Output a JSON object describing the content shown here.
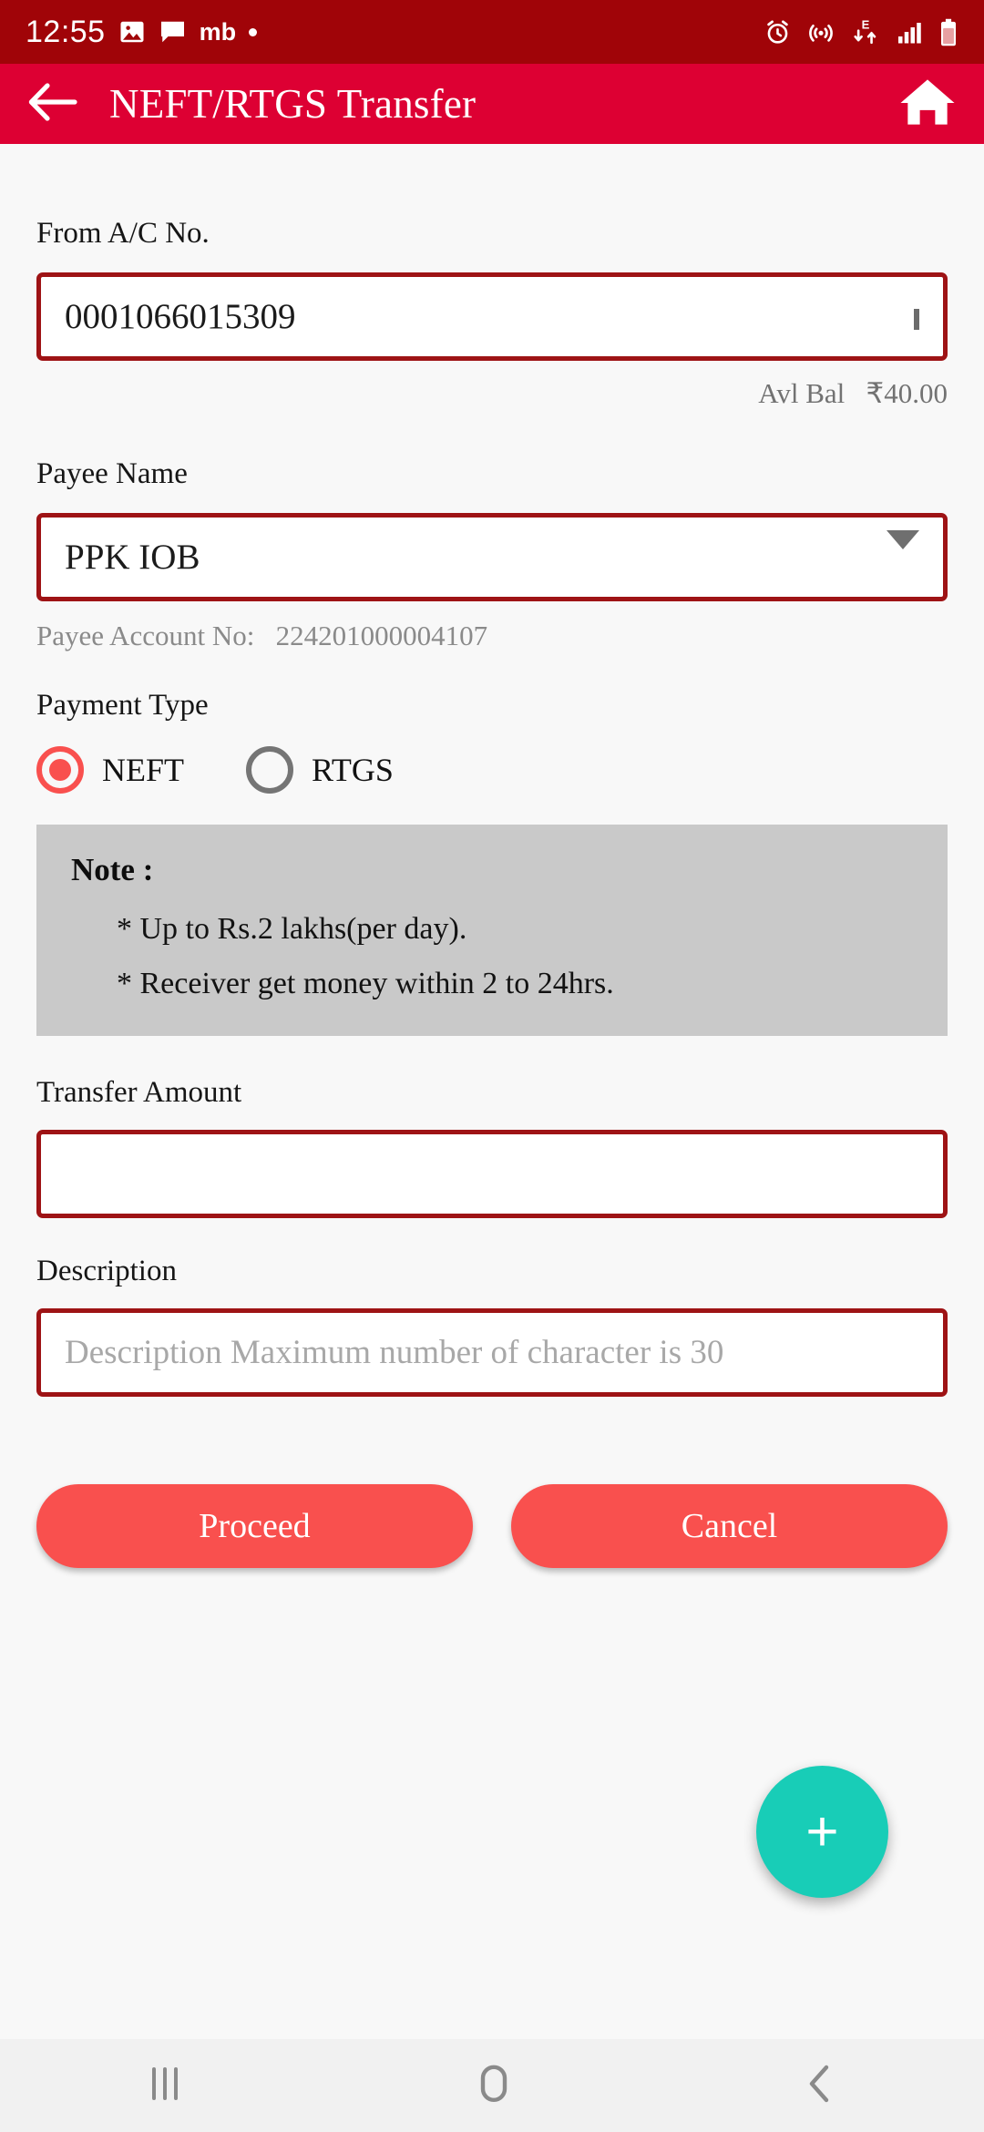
{
  "status_bar": {
    "time": "12:55",
    "carrier_label": "mb",
    "icons_left": [
      "image-icon",
      "message-icon",
      "carrier-text",
      "dot-indicator"
    ],
    "icons_right": [
      "alarm-icon",
      "nearby-share-icon",
      "edge-data-icon",
      "signal-bars-icon",
      "battery-icon"
    ],
    "data_network": "E",
    "background_color": "#a00408"
  },
  "app_bar": {
    "back_icon": "arrow-left-icon",
    "title": "NEFT/RTGS Transfer",
    "home_icon": "home-icon",
    "background_color": "#dd0033"
  },
  "form": {
    "from_account": {
      "label": "From A/C No.",
      "value": "0001066015309",
      "dropdown_icon": "chevron-down-icon",
      "balance_label": "Avl Bal",
      "balance_value": "₹40.00"
    },
    "payee": {
      "label": "Payee Name",
      "value": "PPK IOB",
      "dropdown_icon": "triangle-down-icon",
      "account_label": "Payee Account No:",
      "account_value": "224201000004107"
    },
    "payment_type": {
      "label": "Payment Type",
      "options": [
        {
          "label": "NEFT",
          "selected": true
        },
        {
          "label": "RTGS",
          "selected": false
        }
      ],
      "selected_color": "#f9504e"
    },
    "note": {
      "heading": "Note :",
      "lines": [
        "* Up to Rs.2 lakhs(per day).",
        "* Receiver get money within 2 to 24hrs."
      ],
      "background_color": "#c9c9c9"
    },
    "transfer_amount": {
      "label": "Transfer Amount",
      "value": "",
      "placeholder": ""
    },
    "description": {
      "label": "Description",
      "value": "",
      "placeholder": "Description Maximum number of character is 30"
    }
  },
  "actions": {
    "proceed_label": "Proceed",
    "cancel_label": "Cancel",
    "button_color": "#f9504e",
    "fab_label": "+",
    "fab_color": "#18cdb7"
  },
  "nav_bar": {
    "recents_icon": "recents-icon",
    "home_icon": "home-circle-icon",
    "back_icon": "back-chevron-icon"
  },
  "theme": {
    "field_border": "#9e1315",
    "page_background": "#f8f8f8"
  }
}
